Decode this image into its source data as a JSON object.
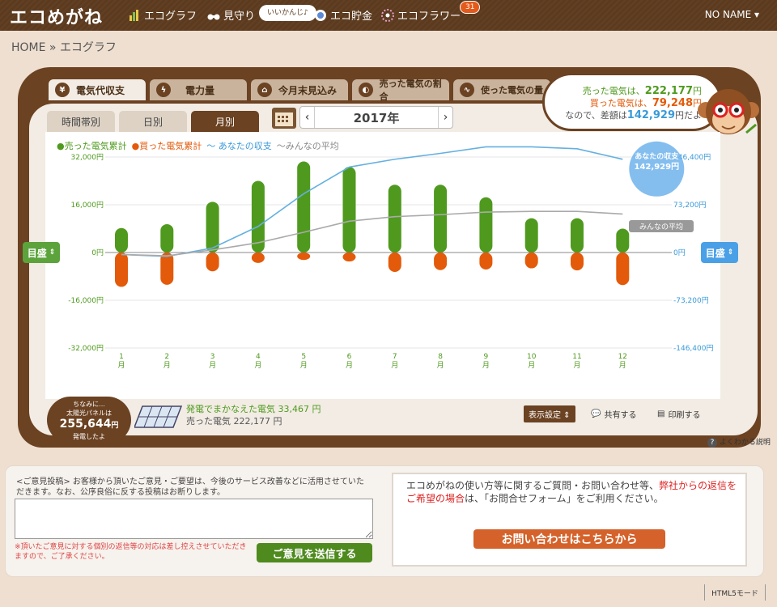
{
  "app": {
    "logo": "エコめがね",
    "user": "NO NAME ▾",
    "breadcrumb": "HOME » エコグラフ"
  },
  "nav": [
    {
      "label": "エコグラフ",
      "icon": "bar-chart-icon"
    },
    {
      "label": "見守り",
      "icon": "binoculars-icon"
    },
    {
      "label": "エコ貯金",
      "icon": "coin-icon"
    },
    {
      "label": "エコフラワー",
      "icon": "flower-icon"
    }
  ],
  "nav_bubble": "いいかんじ♪",
  "nav_badge": "31",
  "tabs": [
    {
      "label": "電気代収支",
      "icon": "¥"
    },
    {
      "label": "電力量",
      "icon": "ϟ"
    },
    {
      "label": "今月末見込み",
      "icon": "⌂"
    },
    {
      "label": "売った電気の割合",
      "icon": "◐"
    },
    {
      "label": "使った電気の量",
      "icon": "∿"
    }
  ],
  "subtabs": [
    "時間帯別",
    "日別",
    "月別"
  ],
  "year": "2017年",
  "summary": {
    "line1_pre": "売った電気は、",
    "line1_val": "222,177",
    "line1_unit": "円",
    "line2_pre": "買った電気は、",
    "line2_val": "79,248",
    "line2_unit": "円",
    "line3_pre": "なので、差額は",
    "line3_val": "142,929",
    "line3_unit": "円だよ"
  },
  "legend": {
    "sold": "●売った電気累計",
    "bought": "●買った電気累計",
    "yours": "〜 あなたの収支",
    "avg": "〜みんなの平均"
  },
  "axis_button": "目盛",
  "chart_data": {
    "type": "bar",
    "categories": [
      "1",
      "2",
      "3",
      "4",
      "5",
      "6",
      "7",
      "8",
      "9",
      "10",
      "11",
      "12"
    ],
    "cat_suffix": "月",
    "series": [
      {
        "name": "売った電気累計",
        "values": [
          8200,
          9500,
          17000,
          24000,
          30500,
          28700,
          22700,
          22700,
          18500,
          11500,
          11500,
          8000
        ],
        "color": "#4f9a1e"
      },
      {
        "name": "買った電気累計",
        "values": [
          -11500,
          -10800,
          -6300,
          -3500,
          -2500,
          -3000,
          -6500,
          -5900,
          -5700,
          -5300,
          -6000,
          -10900
        ],
        "color": "#e35a0a"
      },
      {
        "name": "あなたの収支",
        "values": [
          -3000,
          -6000,
          7000,
          40000,
          90000,
          131000,
          143000,
          152000,
          162000,
          162000,
          159000,
          142929
        ],
        "color": "#65b0e0"
      },
      {
        "name": "みんなの平均",
        "values": [
          -3000,
          -5000,
          4000,
          15000,
          31000,
          48000,
          55000,
          58000,
          62000,
          63000,
          63000,
          59000
        ],
        "color": "#aaaaaa"
      }
    ],
    "yleft": {
      "ticks": [
        "32,000円",
        "16,000円",
        "0円",
        "-16,000円",
        "-32,000円"
      ],
      "range": [
        -32000,
        32000
      ]
    },
    "yright": {
      "ticks": [
        "146,400円",
        "73,200円",
        "0円",
        "-73,200円",
        "-146,400円"
      ],
      "range": [
        -146400,
        146400
      ]
    },
    "callout_yours": {
      "label": "あなたの収支",
      "value": "142,929円"
    },
    "callout_avg": "みんなの平均"
  },
  "solar": {
    "line1": "ちなみに...",
    "line2": "太陽光パネルは",
    "value": "255,644",
    "unit": "円",
    "line3": "発電したよ"
  },
  "footer": {
    "gen": "発電でまかなえた電気 33,467 円",
    "sold": "売った電気 222,177 円"
  },
  "tools": {
    "display": "表示設定 ⇕",
    "share": "共有する",
    "print": "印刷する"
  },
  "help": "よくわかる説明",
  "feedback": {
    "intro": "<ご意見投稿> お客様から頂いたご意見・ご要望は、今後のサービス改善などに活用させていただきます。なお、公序良俗に反する投稿はお断りします。",
    "note": "※頂いたご意見に対する個別の返信等の対応は差し控えさせていただきますので、ご了承ください。",
    "send": "ご意見を送信する"
  },
  "contact": {
    "text1": "エコめがねの使い方等に関するご質問・お問い合わせ等、",
    "text_red": "弊社からの返信をご希望の場合",
    "text2": "は、「お問合せフォーム」をご利用ください。",
    "button": "お問い合わせはこちらから"
  },
  "html5": "HTML5モード"
}
